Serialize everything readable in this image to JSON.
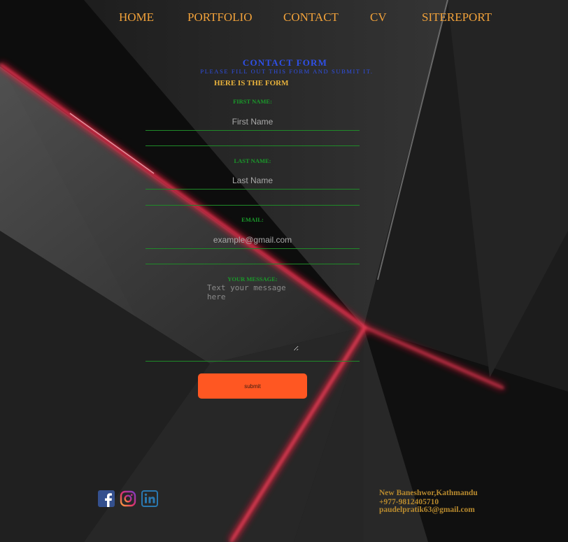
{
  "nav": {
    "home": "HOME",
    "portfolio": "PORTFOLIO",
    "contact": "CONTACT",
    "cv": "CV",
    "sitereport": "SITEREPORT"
  },
  "form": {
    "title": "CONTACT FORM",
    "subtitle": "PLEASE FILL OUT THIS FORM AND SUBMIT IT.",
    "heading": "HERE IS THE FORM",
    "first_name_label": "FIRST NAME:",
    "first_name_placeholder": "First Name",
    "last_name_label": "LAST NAME:",
    "last_name_placeholder": "Last Name",
    "email_label": "EMAIL:",
    "email_placeholder": "example@gmail.com",
    "message_label": "YOUR MESSAGE:",
    "message_placeholder": "Text your message here",
    "submit_label": "submit"
  },
  "social": {
    "facebook_icon": "facebook-icon",
    "instagram_icon": "instagram-icon",
    "linkedin_icon": "linkedin-icon"
  },
  "footer": {
    "address": "New Baneshwor,Kathmandu",
    "phone": "+977-9812405710",
    "email": "paudelpratik63@gmail.com"
  },
  "colors": {
    "nav": "#f2a23a",
    "form_title": "#2f50e8",
    "label": "#1a9a2a",
    "button": "#ff5722",
    "footer_text": "#b88a2e"
  }
}
